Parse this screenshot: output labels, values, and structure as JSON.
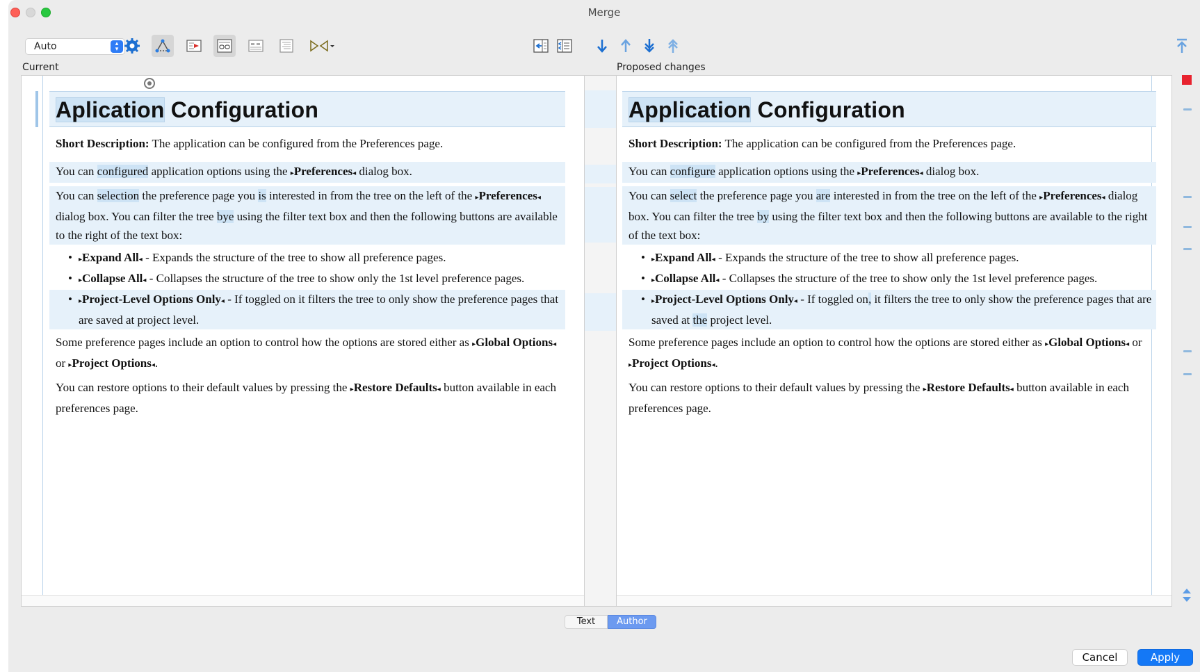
{
  "window": {
    "title": "Merge"
  },
  "toolbar": {
    "mode_select": "Auto",
    "icons": [
      "gear-icon",
      "three-way-merge-icon",
      "show-changes-icon",
      "word-compare-icon",
      "line-compare-icon",
      "ignore-whitespace-icon",
      "auto-merge-icon",
      "copy-change-left-icon",
      "copy-all-left-icon",
      "next-change-icon",
      "previous-change-icon",
      "last-change-icon",
      "first-change-icon",
      "go-top-icon"
    ]
  },
  "panes": {
    "left_label": "Current",
    "right_label": "Proposed changes"
  },
  "left": {
    "title_a": "Aplication",
    "title_b": " Configuration",
    "sd_label": "Short Description:",
    "sd_text": " The application can be configured from the Preferences page.",
    "p1_a": "You can ",
    "p1_hl": "configured",
    "p1_b": " application options using the ",
    "p1_kw": "Preferences",
    "p1_c": " dialog box.",
    "p2_a": "You can ",
    "p2_hl1": "selection",
    "p2_b": " the preference page you ",
    "p2_hl2": "is",
    "p2_c": " interested in from the tree on the left of the ",
    "p2_kw": "Preferences",
    "p2_d": " dialog box. You can filter the tree ",
    "p2_hl3": "bye",
    "p2_e": " using the filter text box and then the following buttons are available to the right of the text box:",
    "li1_kw": "Expand All",
    "li1_text": " - Expands the structure of the tree to show all preference pages.",
    "li2_kw": "Collapse All",
    "li2_text": " - Collapses the structure of the tree to show only the 1st level preference pages.",
    "li3_kw": "Project-Level Options Only",
    "li3_a": " - If toggled on it filters the tree to only show the preference pages that are saved at project level.",
    "p3_a": "Some preference pages include an option to control how the options are stored either as ",
    "p3_kw1": "Global Options",
    "p3_b": " or ",
    "p3_kw2": "Project Options",
    "p3_c": ".",
    "p4_a": "You can restore options to their default values by pressing the ",
    "p4_kw": "Restore Defaults",
    "p4_b": " button available in each preferences page."
  },
  "right": {
    "title_a": "Application",
    "title_b": " Configuration",
    "sd_label": "Short Description:",
    "sd_text": " The application can be configured from the Preferences page.",
    "p1_a": "You can ",
    "p1_hl": "configure",
    "p1_b": " application options using the ",
    "p1_kw": "Preferences",
    "p1_c": " dialog box.",
    "p2_a": "You can ",
    "p2_hl1": "select",
    "p2_b": " the preference page you ",
    "p2_hl2": "are",
    "p2_c": " interested in from the tree on the left of the ",
    "p2_kw": "Preferences",
    "p2_d": " dialog box. You can filter the tree ",
    "p2_hl3": "by",
    "p2_e": " using the filter text box and then the following buttons are available to the right of the text box:",
    "li1_kw": "Expand All",
    "li1_text": " - Expands the structure of the tree to show all preference pages.",
    "li2_kw": "Collapse All",
    "li2_text": " - Collapses the structure of the tree to show only the 1st level preference pages.",
    "li3_kw": "Project-Level Options Only",
    "li3_a": " - If toggled on",
    "li3_hl1": ",",
    "li3_b": " it filters the tree to only show the preference pages that are saved at ",
    "li3_hl2": "the",
    "li3_c": " project level.",
    "p3_a": "Some preference pages include an option to control how the options are stored either as ",
    "p3_kw1": "Global Options",
    "p3_b": " or ",
    "p3_kw2": "Project Options",
    "p3_c": ".",
    "p4_a": "You can restore options to their default values by pressing the ",
    "p4_kw": "Restore Defaults",
    "p4_b": " button available in each preferences page."
  },
  "glyphs": {
    "tag_open": "▸",
    "tag_close": "◂"
  },
  "view_modes": {
    "text": "Text",
    "author": "Author",
    "active": "Author"
  },
  "buttons": {
    "cancel": "Cancel",
    "apply": "Apply"
  },
  "colors": {
    "accent": "#1478f6",
    "diff_band": "#e6f1fa",
    "diff_word": "#cde3f5",
    "conflict": "#e8232f"
  }
}
